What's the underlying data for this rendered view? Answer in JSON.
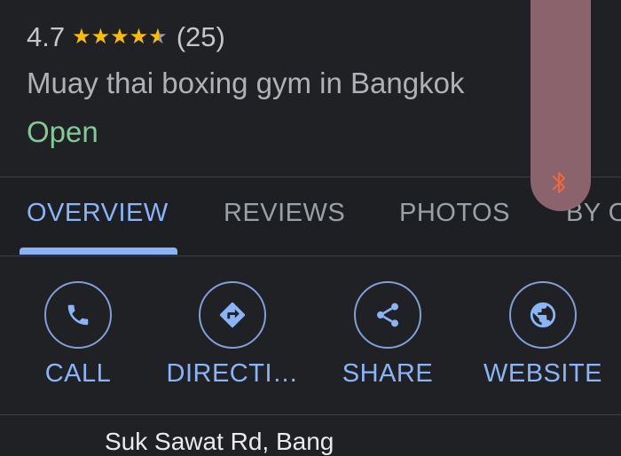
{
  "place": {
    "rating": "4.7",
    "rating_value": 4.7,
    "stars_max": 5,
    "review_count": "(25)",
    "category": "Muay thai boxing gym in Bangkok",
    "status": "Open"
  },
  "tabs": [
    {
      "label": "OVERVIEW",
      "active": true
    },
    {
      "label": "REVIEWS",
      "active": false
    },
    {
      "label": "PHOTOS",
      "active": false
    },
    {
      "label": "BY O",
      "active": false
    }
  ],
  "actions": [
    {
      "label": "CALL",
      "icon": "phone-icon"
    },
    {
      "label": "DIRECTI…",
      "icon": "directions-icon"
    },
    {
      "label": "SHARE",
      "icon": "share-icon"
    },
    {
      "label": "WEBSITE",
      "icon": "globe-icon"
    }
  ],
  "address_partial": "Suk Sawat Rd, Bang",
  "colors": {
    "background": "#202124",
    "accent": "#8ab4f8",
    "star": "#fbbc04",
    "open": "#81c995",
    "overlay": "#8a636c"
  },
  "overlay_icon": "bluetooth-icon"
}
